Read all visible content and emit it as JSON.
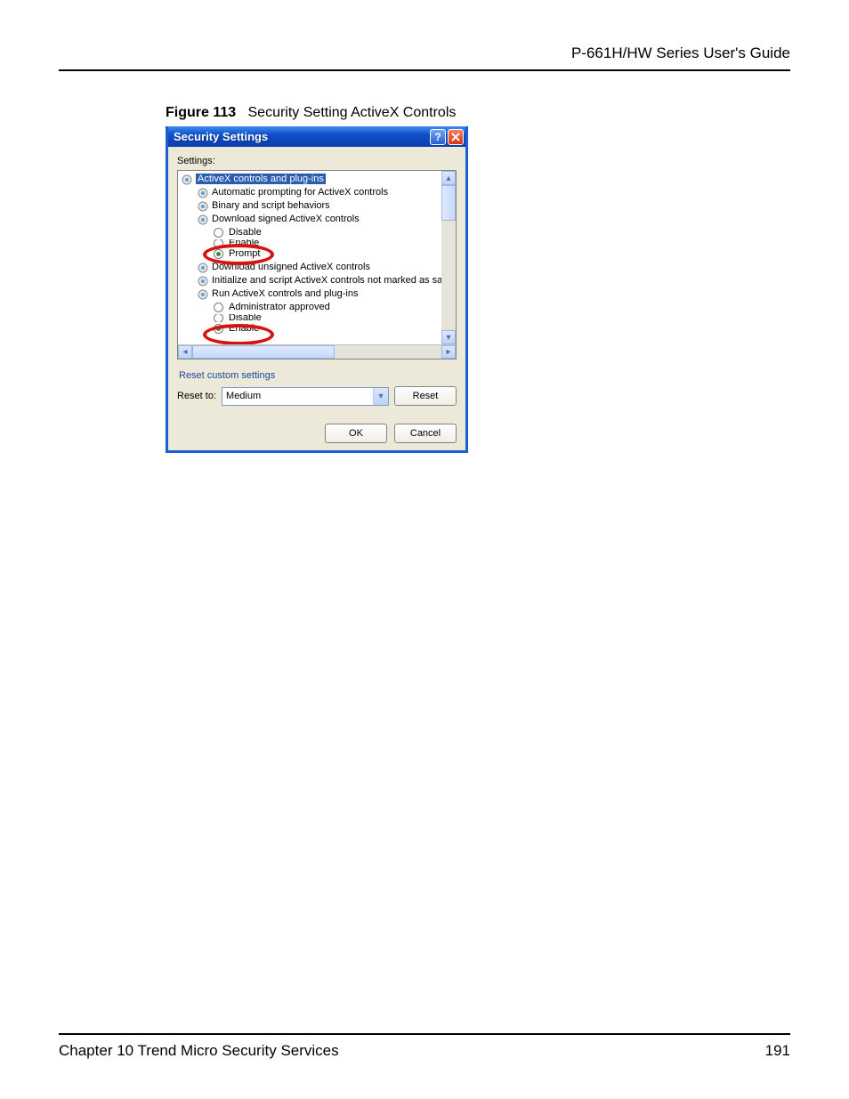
{
  "header": {
    "guide_title": "P-661H/HW Series User's Guide"
  },
  "figure": {
    "number": "Figure 113",
    "caption": "Security Setting ActiveX Controls"
  },
  "dialog": {
    "title": "Security Settings",
    "settings_label": "Settings:",
    "tree": {
      "root": "ActiveX controls and plug-ins",
      "items": [
        "Automatic prompting for ActiveX controls",
        "Binary and script behaviors",
        "Download signed ActiveX controls"
      ],
      "radios1": {
        "disable": "Disable",
        "enable": "Enable",
        "prompt": "Prompt"
      },
      "items2": [
        "Download unsigned ActiveX controls",
        "Initialize and script ActiveX controls not marked as safe",
        "Run ActiveX controls and plug-ins"
      ],
      "radios2": {
        "admin": "Administrator approved",
        "disable": "Disable",
        "enable": "Enable"
      }
    },
    "reset_group": "Reset custom settings",
    "reset_to_label": "Reset to:",
    "reset_value": "Medium",
    "reset_button": "Reset",
    "ok": "OK",
    "cancel": "Cancel"
  },
  "footer": {
    "chapter": "Chapter 10 Trend Micro Security Services",
    "page": "191"
  }
}
